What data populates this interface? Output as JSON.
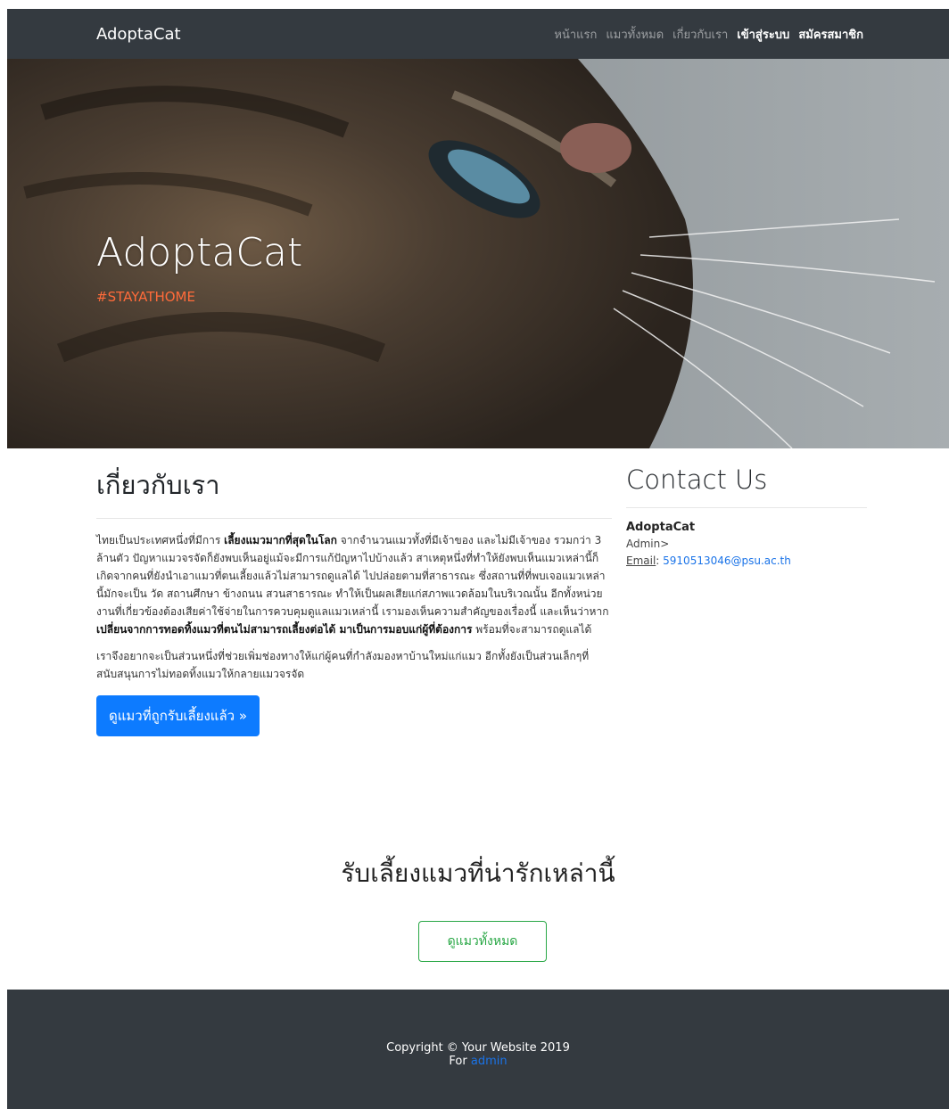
{
  "navbar": {
    "brand": "AdoptaCat",
    "links": [
      "หน้าแรก",
      "แมวทั้งหมด",
      "เกี่ยวกับเรา"
    ],
    "login": "เข้าสู่ระบบ",
    "register": "สมัครสมาชิก"
  },
  "hero": {
    "title": "AdoptaCat",
    "subtitle": "#STAYATHOME"
  },
  "about": {
    "heading": "เกี่ยวกับเรา",
    "p1_a": "ไทยเป็นประเทศหนึ่งที่มีการ ",
    "p1_b": "เลี้ยงแมวมากที่สุดในโลก",
    "p1_c": " จากจำนวนแมวทั้งที่มีเจ้าของ และไม่มีเจ้าของ รวมกว่า 3 ล้านตัว ปัญหาแมวจรจัดก็ยังพบเห็นอยู่แม้จะมีการแก้ปัญหาไปบ้างแล้ว สาเหตุหนึ่งที่ทำให้ยังพบเห็นแมวเหล่านี้ก็เกิดจากคนที่ยังนำเอาแมวที่ตนเลี้ยงแล้วไม่สามารถดูแลได้ ไปปล่อยตามที่สาธารณะ ซึ่งสถานที่ที่พบเจอแมวเหล่านี้มักจะเป็น วัด สถานศึกษา ข้างถนน สวนสาธารณะ ทำให้เป็นผลเสียแก่สภาพแวดล้อมในบริเวณนั้น อีกทั้งหน่วยงานที่เกี่ยวข้องต้องเสียค่าใช้จ่ายในการควบคุมดูแลแมวเหล่านี้ เรามองเห็นความสำคัญของเรื่องนี้ และเห็นว่าหาก",
    "p1_d": "เปลี่ยนจากการทอดทิ้งแมวที่ตนไม่สามารถเลี้ยงต่อได้ มาเป็นการมอบแก่ผู้ที่ต้องการ",
    "p1_e": " พร้อมที่จะสามารถดูแลได้",
    "p2": "เราจึงอยากจะเป็นส่วนหนึ่งที่ช่วยเพิ่มช่องทางให้แก่ผู้คนที่กำลังมองหาบ้านใหม่แก่แมว อีกทั้งยังเป็นส่วนเล็กๆที่สนับสนุนการไม่ทอดทิ้งแมวให้กลายแมวจรจัด",
    "button": "ดูแมวที่ถูกรับเลี้ยงแล้ว »"
  },
  "contact": {
    "heading": "Contact Us",
    "name": "AdoptaCat",
    "role": "Admin>",
    "email_label": "Email",
    "email": "5910513046@psu.ac.th"
  },
  "adopt": {
    "title": "รับเลี้ยงแมวที่น่ารักเหล่านี้",
    "button": "ดูแมวทั้งหมด"
  },
  "footer": {
    "copyright": "Copyright © Your Website 2019",
    "for_label": "For",
    "admin": "admin"
  }
}
